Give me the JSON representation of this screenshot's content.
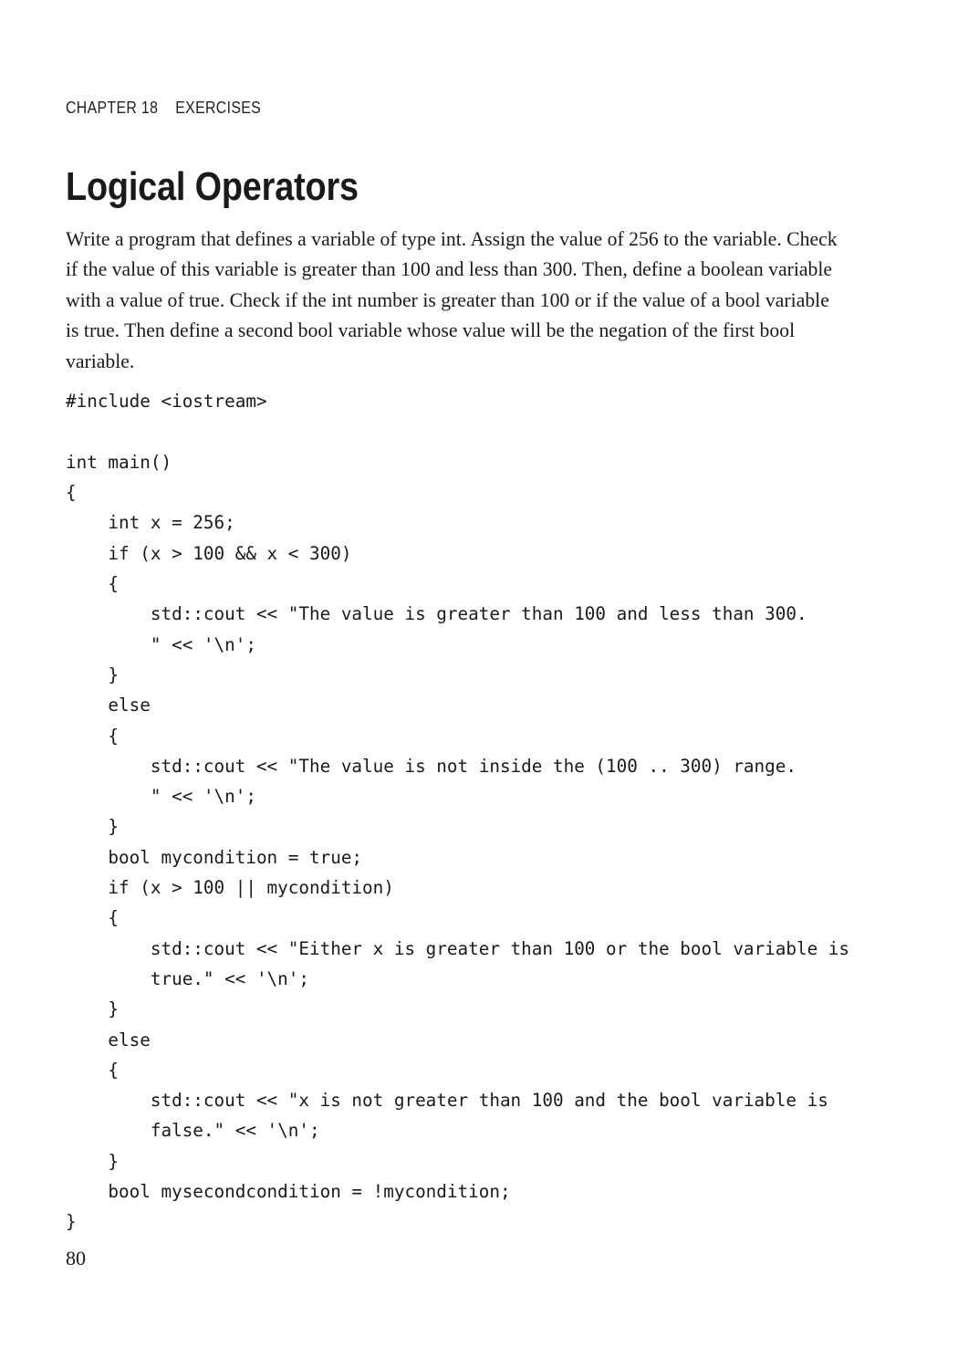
{
  "document": {
    "background_color": "#ffffff",
    "text_color": "#1a1a1a"
  },
  "header": {
    "chapter_label": "CHAPTER 18    EXERCISES"
  },
  "title": "Logical Operators",
  "body": {
    "paragraph": "Write a program that defines a variable of type int. Assign the value of 256 to the variable. Check if the value of this variable is greater than 100 and less than 300. Then, define a boolean variable with a value of true. Check if the int number is greater than 100 or if the value of a bool variable is true. Then define a second bool variable whose value will be the negation of the first bool variable."
  },
  "code": {
    "language": "cpp",
    "lines": [
      "#include <iostream>",
      "",
      "int main()",
      "{",
      "    int x = 256;",
      "    if (x > 100 && x < 300)",
      "    {",
      "        std::cout << \"The value is greater than 100 and less than 300.",
      "        \" << '\\n';",
      "    }",
      "    else",
      "    {",
      "        std::cout << \"The value is not inside the (100 .. 300) range.",
      "        \" << '\\n';",
      "    }",
      "    bool mycondition = true;",
      "    if (x > 100 || mycondition)",
      "    {",
      "        std::cout << \"Either x is greater than 100 or the bool variable is",
      "        true.\" << '\\n';",
      "    }",
      "    else",
      "    {",
      "        std::cout << \"x is not greater than 100 and the bool variable is",
      "        false.\" << '\\n';",
      "    }",
      "    bool mysecondcondition = !mycondition;",
      "}"
    ]
  },
  "footer": {
    "page_number": "80"
  }
}
